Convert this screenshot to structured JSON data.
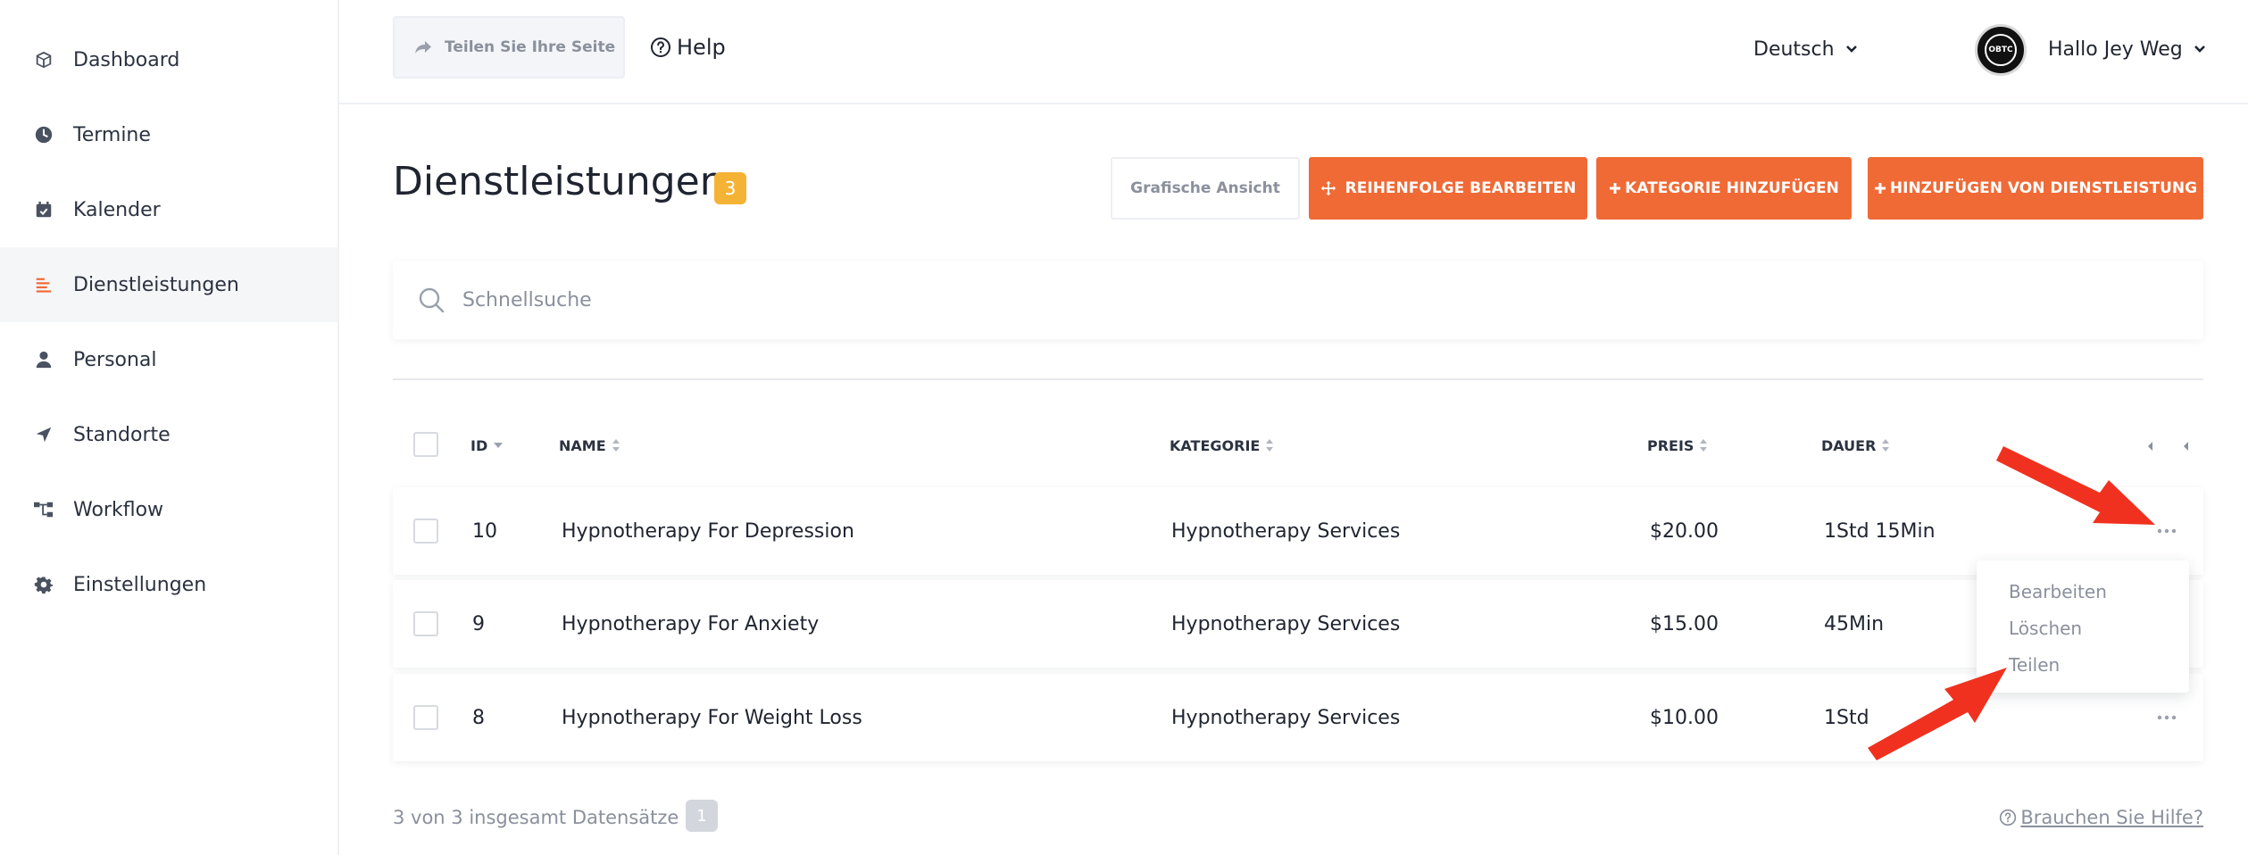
{
  "sidebar": {
    "items": [
      {
        "label": "Dashboard",
        "icon": "cube-icon"
      },
      {
        "label": "Termine",
        "icon": "clock-icon"
      },
      {
        "label": "Kalender",
        "icon": "calendar-check-icon"
      },
      {
        "label": "Dienstleistungen",
        "icon": "list-icon",
        "active": true
      },
      {
        "label": "Personal",
        "icon": "person-icon"
      },
      {
        "label": "Standorte",
        "icon": "location-arrow-icon"
      },
      {
        "label": "Workflow",
        "icon": "workflow-icon"
      },
      {
        "label": "Einstellungen",
        "icon": "gear-icon"
      }
    ]
  },
  "header": {
    "share_label": "Teilen Sie Ihre Seite",
    "help_label": "Help",
    "language": "Deutsch",
    "greeting": "Hallo Jey Weg",
    "avatar_text": "OBTC"
  },
  "page": {
    "title": "Dienstleistungen",
    "count": "3",
    "btn_graphic": "Grafische Ansicht",
    "btn_reorder": "REIHENFOLGE BEARBEITEN",
    "btn_add_category": "KATEGORIE HINZUFÜGEN",
    "btn_add_service": "HINZUFÜGEN VON DIENSTLEISTUNG"
  },
  "search": {
    "placeholder": "Schnellsuche"
  },
  "table": {
    "headers": {
      "id": "ID",
      "name": "NAME",
      "category": "KATEGORIE",
      "price": "PREIS",
      "duration": "DAUER"
    },
    "rows": [
      {
        "id": "10",
        "name": "Hypnotherapy For Depression",
        "category": "Hypnotherapy Services",
        "price": "$20.00",
        "duration": "1Std 15Min"
      },
      {
        "id": "9",
        "name": "Hypnotherapy For Anxiety",
        "category": "Hypnotherapy Services",
        "price": "$15.00",
        "duration": "45Min"
      },
      {
        "id": "8",
        "name": "Hypnotherapy For Weight Loss",
        "category": "Hypnotherapy Services",
        "price": "$10.00",
        "duration": "1Std"
      }
    ]
  },
  "row_menu": {
    "items": [
      "Bearbeiten",
      "Löschen",
      "Teilen"
    ]
  },
  "footer": {
    "records_text": "3 von 3 insgesamt Datensätze",
    "page": "1",
    "help_text": "Brauchen Sie Hilfe?"
  },
  "colors": {
    "accent": "#f06a36",
    "badge": "#f5b335",
    "annotation_arrow": "#f0311f"
  }
}
